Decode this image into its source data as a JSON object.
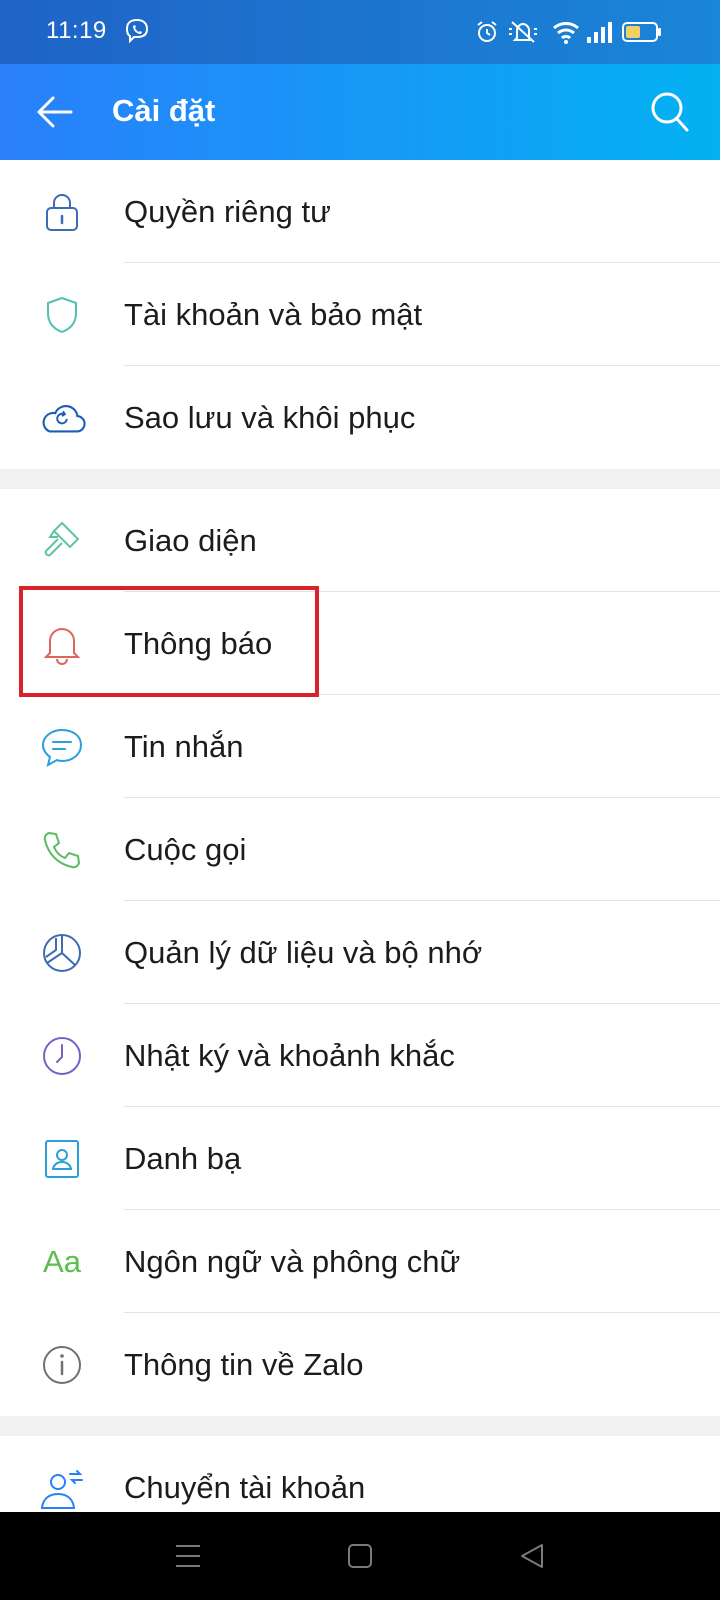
{
  "status_bar": {
    "time": "11:19"
  },
  "app_bar": {
    "title": "Cài đặt"
  },
  "groups": [
    {
      "items": [
        {
          "label": "Quyền riêng tư",
          "icon": "lock-icon"
        },
        {
          "label": "Tài khoản và bảo mật",
          "icon": "shield-icon"
        },
        {
          "label": "Sao lưu và khôi phục",
          "icon": "cloud-restore-icon"
        }
      ]
    },
    {
      "items": [
        {
          "label": "Giao diện",
          "icon": "paint-brush-icon"
        },
        {
          "label": "Thông báo",
          "icon": "bell-icon"
        },
        {
          "label": "Tin nhắn",
          "icon": "chat-bubble-icon"
        },
        {
          "label": "Cuộc gọi",
          "icon": "phone-icon"
        },
        {
          "label": "Quản lý dữ liệu và bộ nhớ",
          "icon": "pie-chart-icon"
        },
        {
          "label": "Nhật ký và khoảnh khắc",
          "icon": "clock-icon"
        },
        {
          "label": "Danh bạ",
          "icon": "contact-card-icon"
        },
        {
          "label": "Ngôn ngữ và phông chữ",
          "icon": "font-icon",
          "icon_text": "Aa"
        },
        {
          "label": "Thông tin về Zalo",
          "icon": "info-icon"
        }
      ]
    },
    {
      "items": [
        {
          "label": "Chuyển tài khoản",
          "icon": "switch-account-icon"
        }
      ]
    }
  ],
  "colors": {
    "accent": "#2a7ffb",
    "highlight": "#d8232a"
  }
}
